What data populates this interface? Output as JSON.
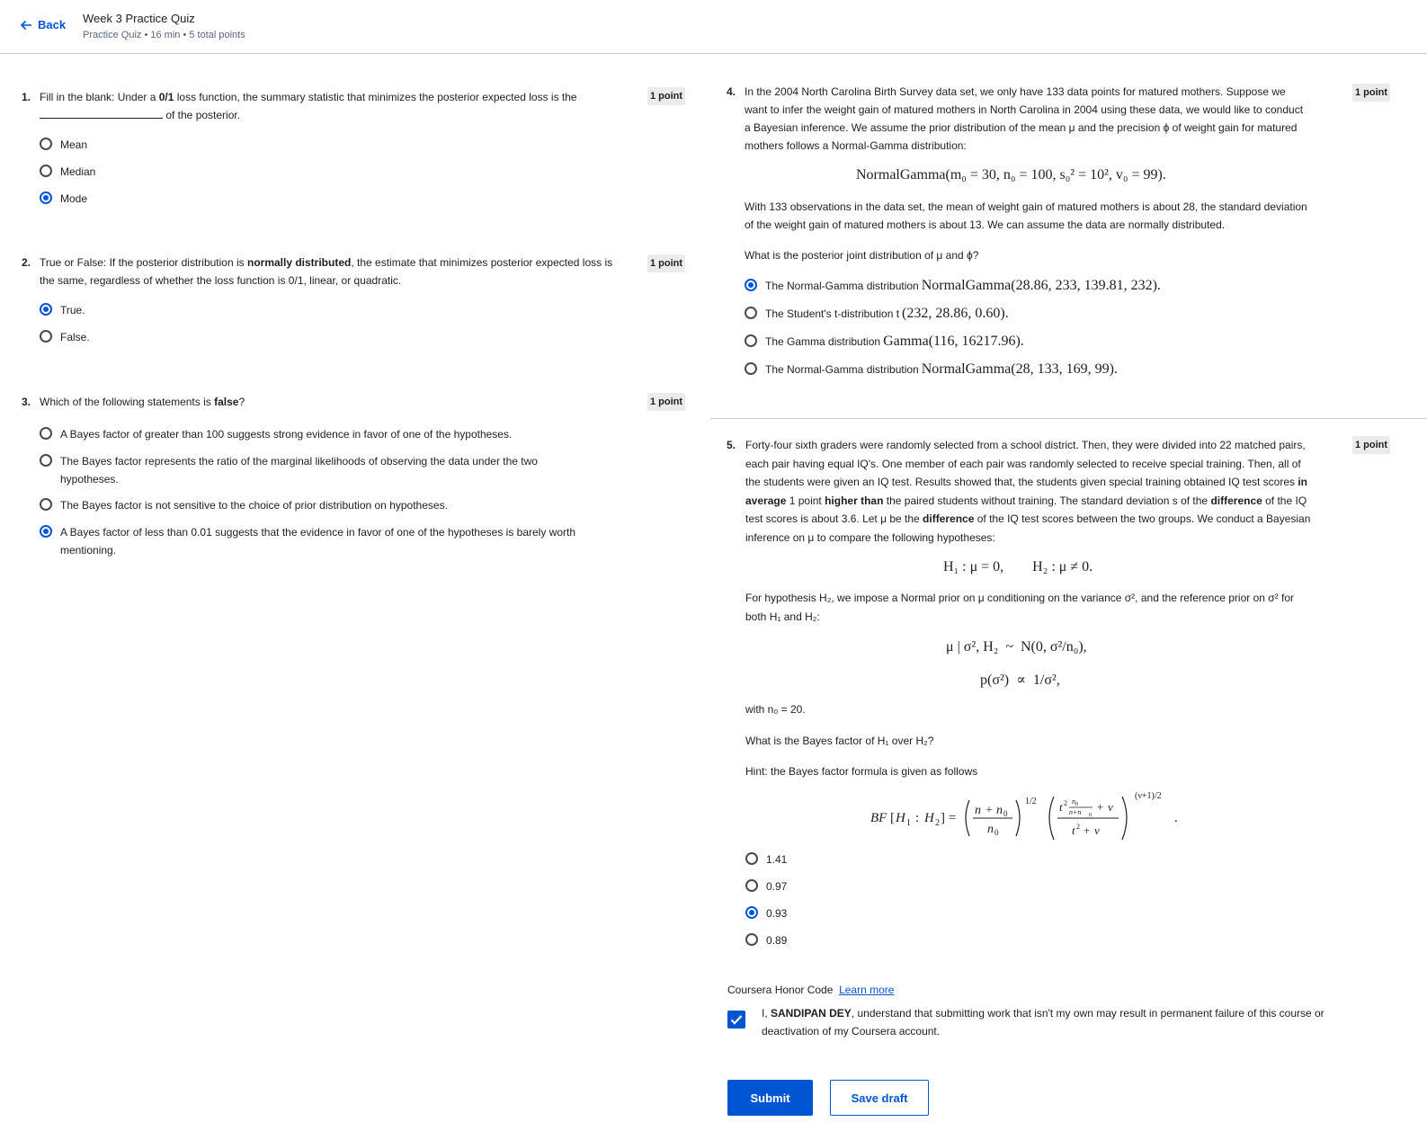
{
  "header": {
    "back_label": "Back",
    "title": "Week 3 Practice Quiz",
    "meta": "Practice Quiz • 16 min • 5 total points"
  },
  "points_label": "1 point",
  "q1": {
    "number": "1.",
    "text_a": "Fill in the blank: Under a ",
    "text_bold": "0/1",
    "text_b": " loss function, the summary statistic that minimizes the posterior expected loss is the",
    "text_c": " of the posterior.",
    "options": [
      "Mean",
      "Median",
      "Mode"
    ]
  },
  "q2": {
    "number": "2.",
    "text_a": "True or False: If the posterior distribution is ",
    "text_bold": "normally distributed",
    "text_b": ", the estimate that minimizes posterior expected loss is the same, regardless of whether the loss function is 0/1, linear, or quadratic.",
    "options": [
      "True.",
      "False."
    ]
  },
  "q3": {
    "number": "3.",
    "text_a": "Which of the following statements is ",
    "text_bold": "false",
    "text_b": "?",
    "options": [
      "A Bayes factor of greater than 100 suggests strong evidence in favor of one of the hypotheses.",
      "The Bayes factor represents the ratio of the marginal likelihoods of observing the data under the two hypotheses.",
      "The Bayes factor is not  sensitive to the choice of prior distribution on hypotheses.",
      "A Bayes factor of less than 0.01 suggests that the evidence in favor of one of the hypotheses is barely worth mentioning."
    ]
  },
  "q4": {
    "number": "4.",
    "para1": "In the 2004 North Carolina Birth Survey data set, we only have 133 data points for matured mothers. Suppose we want to infer the weight gain of matured mothers in North Carolina in 2004 using these data, we would like to conduct a Bayesian inference. We assume the prior distribution of the mean μ and the precision ϕ of weight gain for matured mothers follows a Normal-Gamma distribution:",
    "formula": "NormalGamma(m₀ = 30, n₀ = 100, s₀² = 10², v₀ = 99).",
    "para2": "With 133 observations in the data set, the mean of weight gain of matured mothers is about 28, the standard deviation of the weight gain of matured mothers is about 13. We can assume the data are normally distributed.",
    "question": "What is the posterior joint distribution of μ and ϕ?",
    "options": [
      {
        "text": "The Normal-Gamma distribution ",
        "math": "NormalGamma(28.86, 233, 139.81, 232)."
      },
      {
        "text": "The Student's t-distribution t ",
        "math": "(232, 28.86, 0.60)."
      },
      {
        "text": "The Gamma distribution ",
        "math": "Gamma(116, 16217.96)."
      },
      {
        "text": "The Normal-Gamma distribution ",
        "math": "NormalGamma(28, 133, 169, 99)."
      }
    ]
  },
  "q5": {
    "number": "5.",
    "para1_a": "Forty-four sixth graders were randomly selected from a school district. Then, they were divided into 22 matched pairs, each pair having equal IQ's. One member of each pair was randomly selected to receive special training. Then, all of the students were given an IQ test. Results showed that, the students given special training obtained IQ test scores ",
    "para1_b1": "in average",
    "para1_c": " 1 point ",
    "para1_b2": "higher than",
    "para1_d": " the paired students without training. The standard deviation s of the ",
    "para1_b3": "difference",
    "para1_e": " of the IQ test scores is about 3.6. Let μ be the ",
    "para1_b4": "difference",
    "para1_f": " of the IQ test scores between the two groups. We conduct a Bayesian inference on μ to compare the following hypotheses:",
    "hyp": "H₁ : μ = 0,        H₂ : μ ≠ 0.",
    "para2": "For hypothesis H₂, we impose a Normal prior on μ conditioning on the variance σ², and the reference prior on σ² for both H₁ and H₂:",
    "prior1": "μ | σ², H₂  ~  N(0, σ²/n₀),",
    "prior2": "p(σ²)  ∝  1/σ²,",
    "with_n0": "with n₀ = 20.",
    "question": "What is the Bayes factor of H₁ over H₂?",
    "hint": "Hint: the Bayes factor formula is given as follows",
    "options": [
      "1.41",
      "0.97",
      "0.93",
      "0.89"
    ]
  },
  "honor": {
    "label": "Coursera Honor Code",
    "learn_more": "Learn more",
    "text_a": "I, ",
    "name": "SANDIPAN DEY",
    "text_b": ", understand that submitting work that isn't my own may result in permanent failure of this course or deactivation of my Coursera account."
  },
  "buttons": {
    "submit": "Submit",
    "save_draft": "Save draft"
  },
  "colors": {
    "accent": "#0056d2"
  }
}
